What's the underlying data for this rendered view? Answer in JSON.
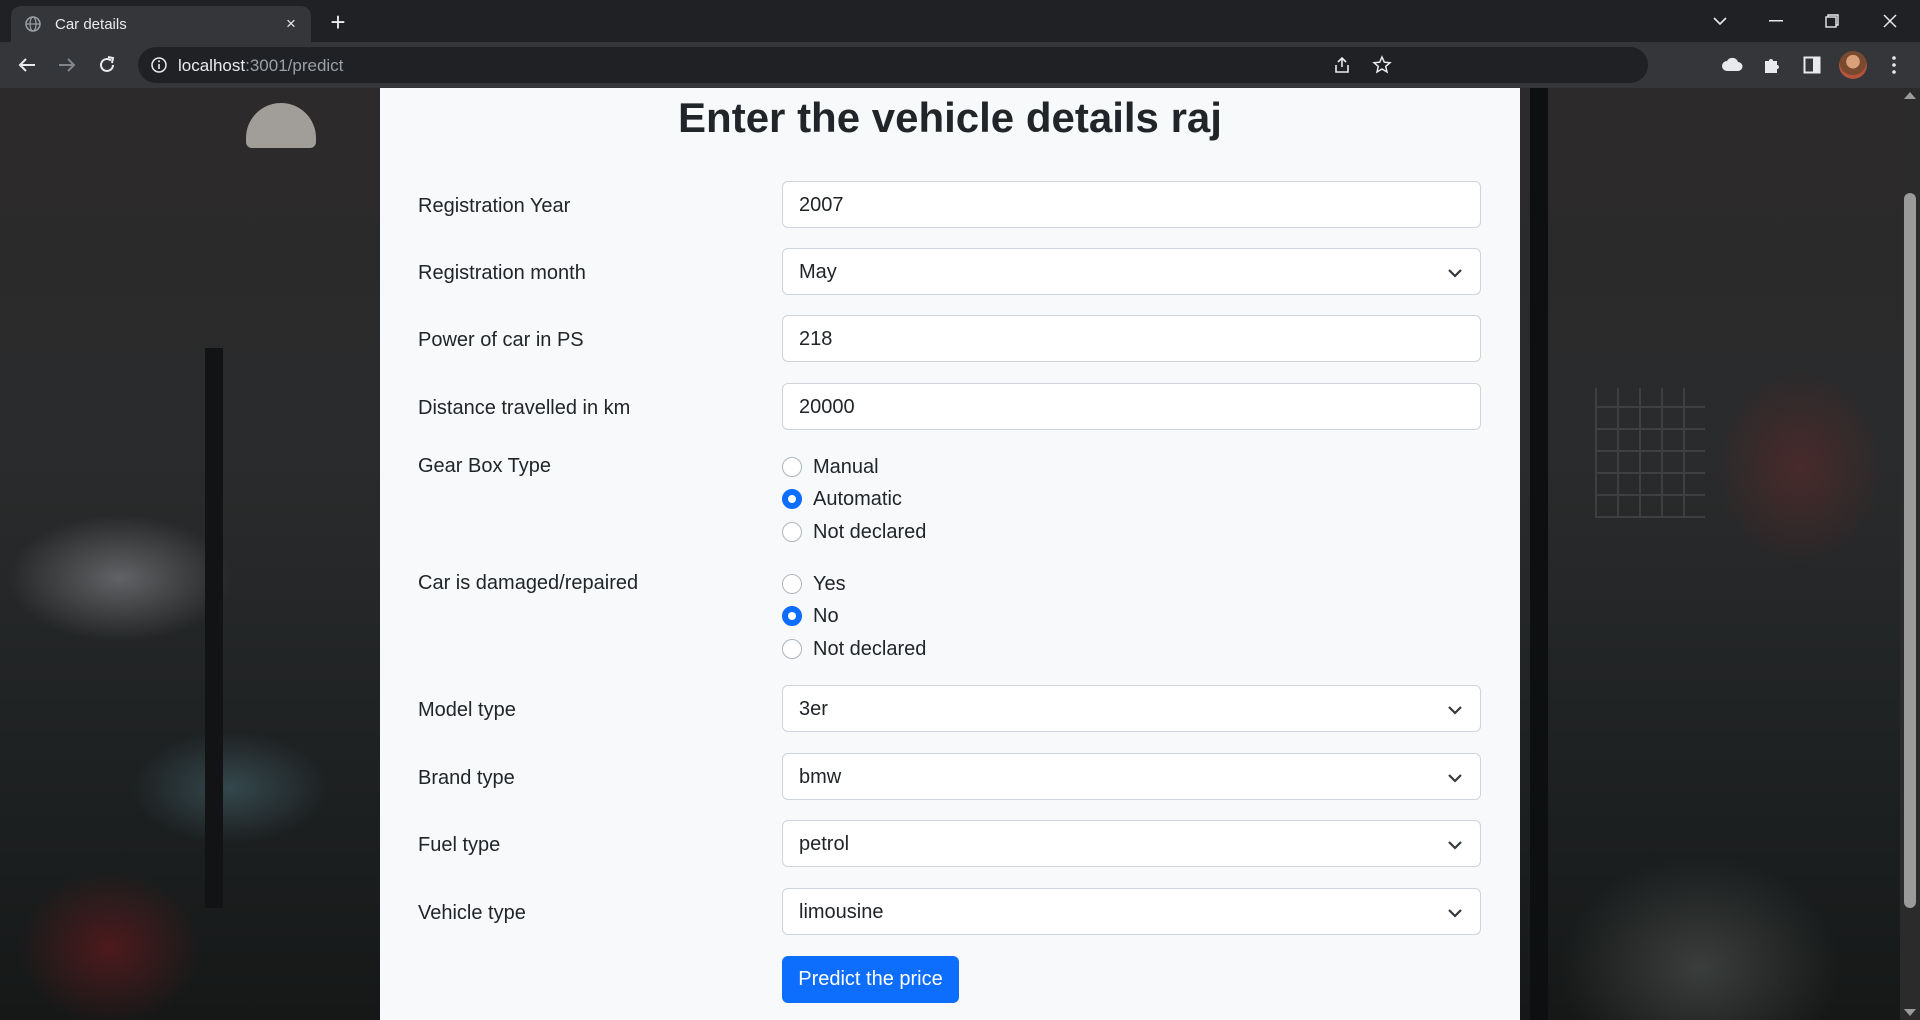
{
  "browser": {
    "tab_title": "Car details",
    "tab_close": "×",
    "new_tab": "+",
    "url_host": "localhost",
    "url_path": ":3001/predict"
  },
  "page": {
    "title": "Enter the vehicle details raj",
    "registration_year": {
      "label": "Registration Year",
      "value": "2007"
    },
    "registration_month": {
      "label": "Registration month",
      "value": "May"
    },
    "power": {
      "label": "Power of car in PS",
      "value": "218"
    },
    "distance": {
      "label": "Distance travelled in km",
      "value": "20000"
    },
    "gearbox": {
      "label": "Gear Box Type",
      "options": [
        {
          "label": "Manual",
          "checked": false
        },
        {
          "label": "Automatic",
          "checked": true
        },
        {
          "label": "Not declared",
          "checked": false
        }
      ]
    },
    "damaged": {
      "label": "Car is damaged/repaired",
      "options": [
        {
          "label": "Yes",
          "checked": false
        },
        {
          "label": "No",
          "checked": true
        },
        {
          "label": "Not declared",
          "checked": false
        }
      ]
    },
    "model": {
      "label": "Model type",
      "value": "3er"
    },
    "brand": {
      "label": "Brand type",
      "value": "bmw"
    },
    "fuel": {
      "label": "Fuel type",
      "value": "petrol"
    },
    "vehicle": {
      "label": "Vehicle type",
      "value": "limousine"
    },
    "submit_label": "Predict the price"
  },
  "colors": {
    "accent": "#0d6efd",
    "card": "#f8f9fa",
    "chrome": "#35363a"
  }
}
